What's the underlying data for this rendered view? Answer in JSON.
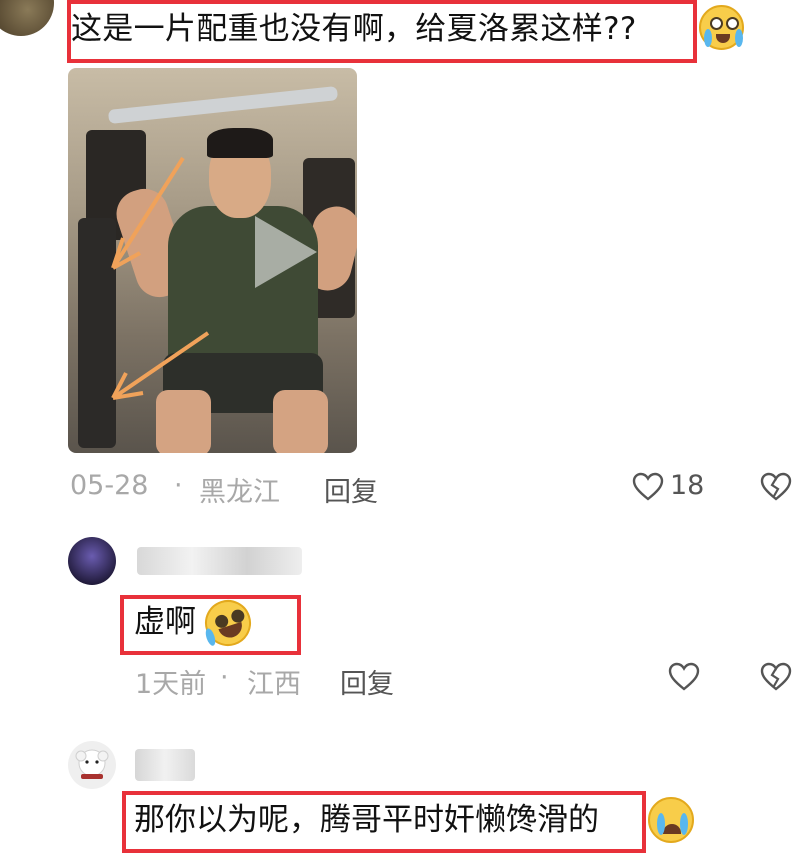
{
  "comments": [
    {
      "text": "这是一片配重也没有啊，给夏洛累这样??",
      "date": "05-28",
      "location": "黑龙江",
      "reply_label": "回复",
      "likes": "18",
      "has_video": true
    },
    {
      "text": "虚啊",
      "time": "1天前",
      "location": "江西",
      "reply_label": "回复"
    },
    {
      "text": "那你以为呢，腾哥平时奸懒馋滑的"
    }
  ],
  "separator": "·",
  "colors": {
    "highlight_border": "#e8313a",
    "meta_text": "#a8a8a8"
  },
  "icons": [
    "heart-icon",
    "broken-heart-icon",
    "play-icon"
  ]
}
